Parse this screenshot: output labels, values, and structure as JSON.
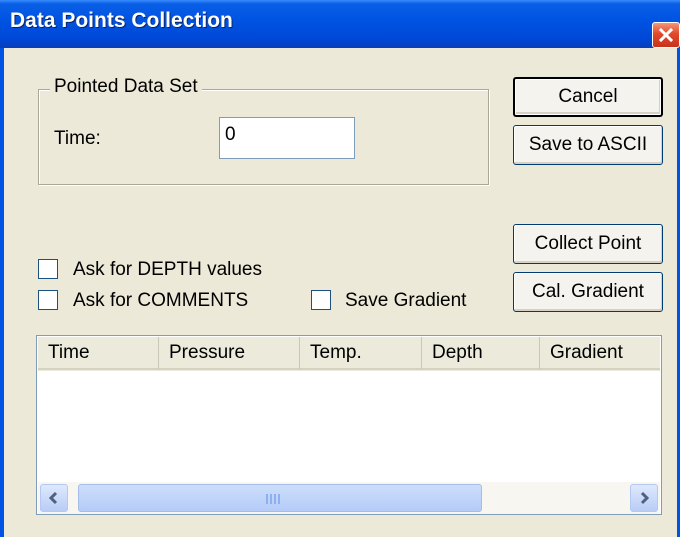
{
  "window": {
    "title": "Data Points Collection",
    "close_icon": "close-icon"
  },
  "group": {
    "legend": "Pointed Data Set",
    "time_label": "Time:",
    "time_value": "0"
  },
  "buttons": {
    "cancel": "Cancel",
    "save_ascii": "Save to ASCII",
    "collect_point": "Collect Point",
    "cal_gradient": "Cal. Gradient"
  },
  "checkboxes": {
    "ask_depth": "Ask for DEPTH values",
    "ask_comments": "Ask for COMMENTS",
    "save_gradient": "Save Gradient"
  },
  "list": {
    "columns": [
      "Time",
      "Pressure",
      "Temp.",
      "Depth",
      "Gradient"
    ],
    "rows": []
  },
  "colors": {
    "titlebar": "#0054e3",
    "dialog_bg": "#ece9d8",
    "close_button": "#e2492a"
  }
}
